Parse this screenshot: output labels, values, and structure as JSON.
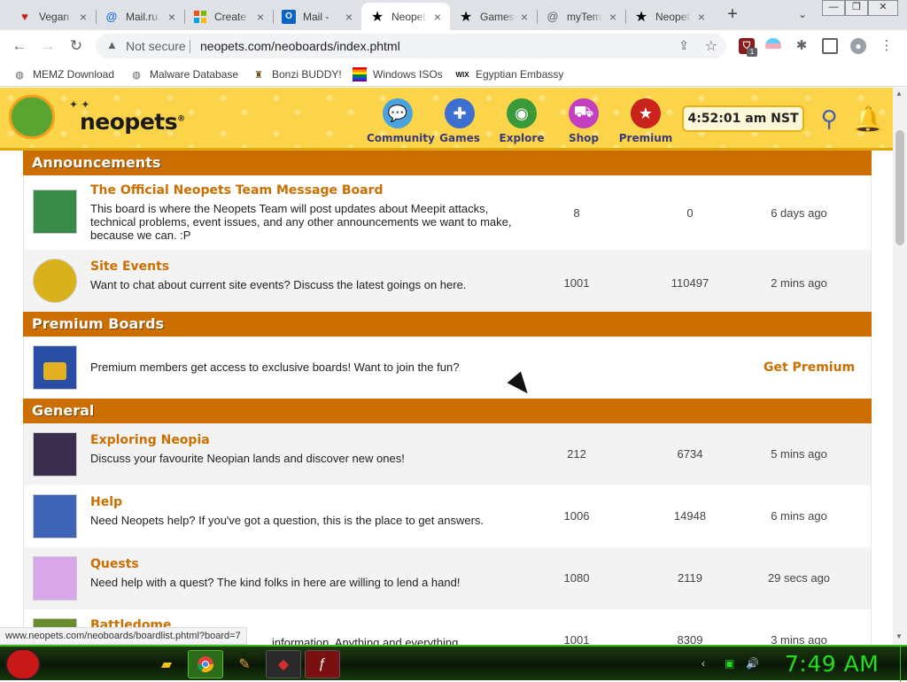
{
  "browser": {
    "tabs": [
      {
        "title": "Vegan",
        "icon": "heart-favicon",
        "color": "#c5221f"
      },
      {
        "title": "Mail.ru",
        "icon": "at-favicon",
        "color": "#1a73e8"
      },
      {
        "title": "Create",
        "icon": "windows-favicon",
        "color": "#f25022"
      },
      {
        "title": "Mail -",
        "icon": "outlook-favicon",
        "color": "#0a64c8"
      },
      {
        "title": "Neopets",
        "icon": "star-favicon",
        "color": "#000000",
        "active": true
      },
      {
        "title": "Games",
        "icon": "star-favicon",
        "color": "#000000"
      },
      {
        "title": "myTemp",
        "icon": "at-favicon",
        "color": "#5f6368"
      },
      {
        "title": "Neopets",
        "icon": "star-favicon",
        "color": "#000000"
      }
    ],
    "new_tab_label": "+",
    "security_label": "Not secure",
    "url": "neopets.com/neoboards/index.phtml",
    "status_url": "www.neopets.com/neoboards/boardlist.phtml?board=7",
    "extension_badge": "1",
    "bookmarks": [
      {
        "label": "MEMZ Download",
        "icon": "globe-icon"
      },
      {
        "label": "Malware Database",
        "icon": "globe-icon"
      },
      {
        "label": "Bonzi BUDDY!",
        "icon": "bonzi-icon"
      },
      {
        "label": "Windows ISOs",
        "icon": "windows-flag-icon"
      },
      {
        "label": "Egyptian Embassy",
        "icon": "wix-icon"
      }
    ],
    "wix_text": "WIX"
  },
  "site": {
    "logo": "neopets",
    "logo_mark": "®",
    "nav": [
      {
        "label": "Community",
        "icon": "speech-bubble-icon",
        "color": "#4aa3df"
      },
      {
        "label": "Games",
        "icon": "gamepad-icon",
        "color": "#3d6fd0"
      },
      {
        "label": "Explore",
        "icon": "globe-icon",
        "color": "#3a9a3a"
      },
      {
        "label": "Shop",
        "icon": "cart-icon",
        "color": "#c23fbf"
      },
      {
        "label": "Premium",
        "icon": "star-badge-icon",
        "color": "#c8241b"
      }
    ],
    "clock": "4:52:01 am NST",
    "accent": "#cd6f00"
  },
  "sections": [
    {
      "title": "Announcements",
      "boards": [
        {
          "name": "The Official Neopets Team Message Board",
          "desc": "This board is where the Neopets Team will post updates about Meepit attacks, technical problems, event issues, and any other announcements we want to make, because we can. :P",
          "topics": "8",
          "replies": "0",
          "last": "6 days ago",
          "thumb_color": "#3a8a4a"
        },
        {
          "name": "Site Events",
          "desc": "Want to chat about current site events? Discuss the latest goings on here.",
          "topics": "1001",
          "replies": "110497",
          "last": "2 mins ago",
          "thumb_color": "#d9b21b"
        }
      ]
    },
    {
      "title": "Premium Boards",
      "premium_text": "Premium members get access to exclusive boards! Want to join the fun?",
      "premium_cta": "Get Premium"
    },
    {
      "title": "General",
      "boards": [
        {
          "name": "Exploring Neopia",
          "desc": "Discuss your favourite Neopian lands and discover new ones!",
          "topics": "212",
          "replies": "6734",
          "last": "5 mins ago",
          "thumb_color": "#3b2d4e"
        },
        {
          "name": "Help",
          "desc": "Need Neopets help? If you've got a question, this is the place to get answers.",
          "topics": "1006",
          "replies": "14948",
          "last": "6 mins ago",
          "thumb_color": "#3f64b5"
        },
        {
          "name": "Quests",
          "desc": "Need help with a quest? The kind folks in here are willing to lend a hand!",
          "topics": "1080",
          "replies": "2119",
          "last": "29 secs ago",
          "thumb_color": "#d9a7e8"
        },
        {
          "name": "Battledome",
          "desc": "information. Anything and everything",
          "topics": "1001",
          "replies": "8309",
          "last": "3 mins ago",
          "thumb_color": "#6b8c2a"
        }
      ]
    }
  ],
  "taskbar": {
    "clock": "7:49 AM",
    "accent": "#21e017"
  }
}
